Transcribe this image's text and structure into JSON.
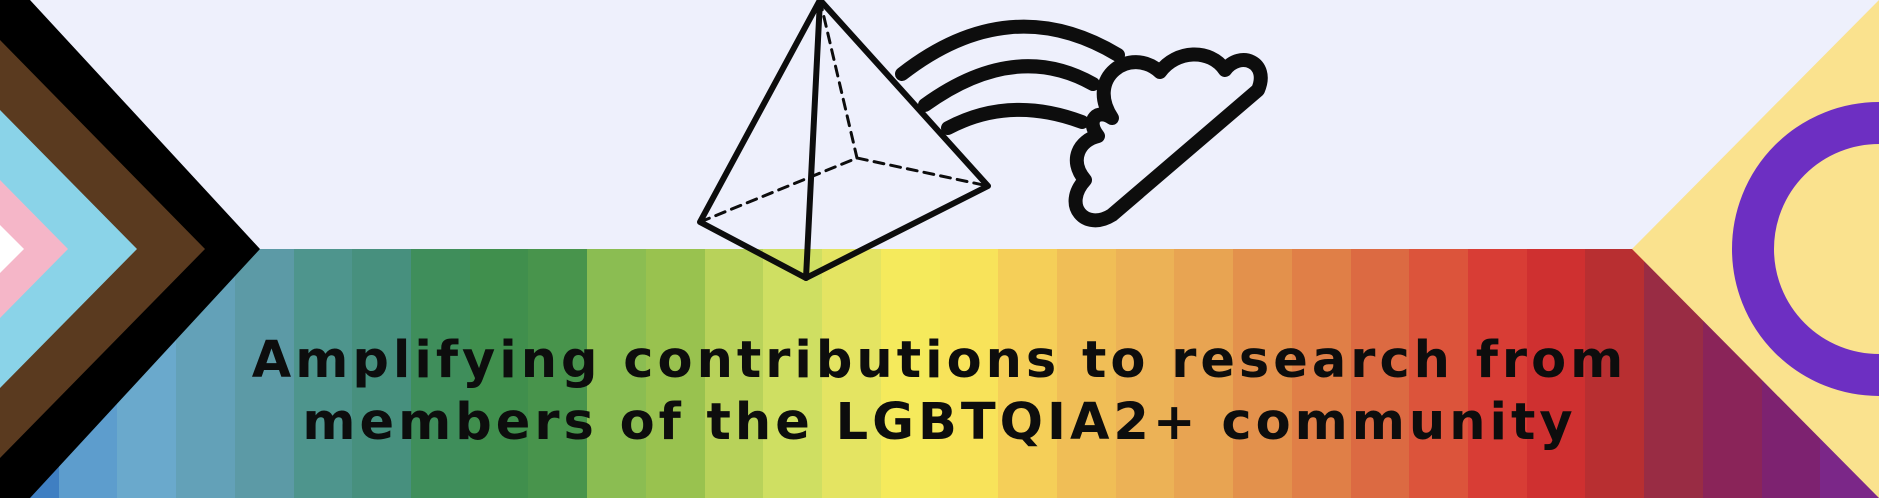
{
  "headline": {
    "line1": "Amplifying contributions to research from",
    "line2": "members of the LGBTQIA2+ community"
  },
  "colors": {
    "background": "#eef0fc",
    "text": "#0d0d0d",
    "spectrum": [
      "#3f7fc2",
      "#5d9dcd",
      "#6aa9cc",
      "#63a1b8",
      "#5c9aa6",
      "#4e958d",
      "#47907e",
      "#3f8e5b",
      "#408f4d",
      "#48944c",
      "#8bbd52",
      "#99c24f",
      "#b8d25a",
      "#cfdf62",
      "#e4e462",
      "#f5ea5c",
      "#f8e35a",
      "#f5cf58",
      "#f0be56",
      "#ecb256",
      "#e8a452",
      "#e3914c",
      "#e07f47",
      "#dc6a42",
      "#dc543b",
      "#d83d35",
      "#cf3030",
      "#b82f31",
      "#992c44",
      "#8a2459",
      "#7d2270",
      "#7b2788"
    ],
    "progress_chevrons": [
      "#000000",
      "#5a3a1f",
      "#8ad3e8",
      "#f5b6c8",
      "#ffffff"
    ],
    "intersex_yellow": "#fae28e",
    "intersex_purple": "#6d2fc2"
  }
}
